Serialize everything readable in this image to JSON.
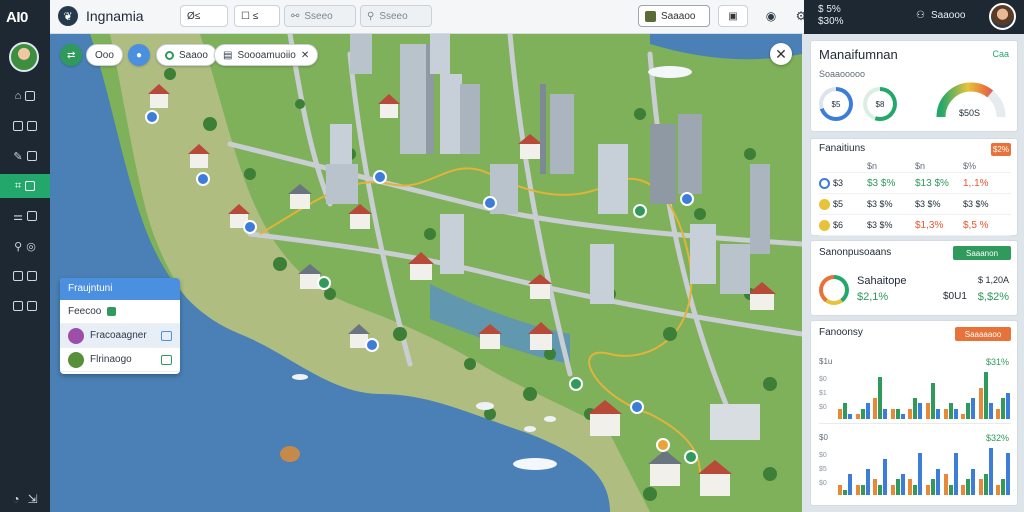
{
  "app": {
    "logo": "AI0",
    "title": "Ingnamia"
  },
  "toolbar": {
    "view_btn": "Ø≤",
    "tools_btn": "☐ ≤",
    "search1": "Sseeo",
    "search2": "Sseeo",
    "status_btn": "Saaaoo",
    "stat_line1": "$ 5%",
    "stat_line2": "$30%",
    "user_label": "Saaooo"
  },
  "map_chips": {
    "chip1": "Ooo",
    "chip2": "Saaoo",
    "chip3": "Soooamuoiio"
  },
  "layers": {
    "header": "Fraujntuni",
    "row1": "Feecoo",
    "row2": "Fracoaagner",
    "row3": "Flrinaogo"
  },
  "panel": {
    "card1": {
      "title": "Manaifumnan",
      "tag": "Caa",
      "subtitle": "Soaaooooo",
      "ring1": "$5",
      "ring2": "$8",
      "gauge_label": "$50S",
      "gauge_percent": 72,
      "color_accent": "#22a86b"
    },
    "card2": {
      "title": "Fanaitiuns",
      "badge": "$2%",
      "headers": [
        "",
        "$n",
        "$n",
        "$%"
      ],
      "rows": [
        [
          "$3",
          "$3 $%",
          "$13 $%",
          "1,.1%"
        ],
        [
          "$5",
          "$3 $%",
          "$3 $%",
          "$3 $%"
        ],
        [
          "$6",
          "$3 $%",
          "$1,3%",
          "$,5 %"
        ]
      ]
    },
    "card3": {
      "title": "Sanonpusoaans",
      "button": "Saaanon",
      "item_title": "Sahaitope",
      "item_value": "$ 1,20A",
      "pct1": "$2,1%",
      "pct2": "$0U1",
      "pct3": "$,$2%"
    },
    "card4": {
      "title": "Fanoonsy",
      "button": "Saaaaaoo",
      "chart1": {
        "label_left": "$1u",
        "label_right": "$31%",
        "ticks": [
          "$0",
          "$1",
          "$0"
        ],
        "colors": [
          "#e8893a",
          "#2f9a5c",
          "#3b7dd8"
        ],
        "series": [
          {
            "values": [
              0.2,
              0.1,
              0.4,
              0.2,
              0.2,
              0.3,
              0.2,
              0.1,
              0.6,
              0.2
            ]
          },
          {
            "values": [
              0.3,
              0.2,
              0.8,
              0.2,
              0.4,
              0.7,
              0.3,
              0.3,
              0.9,
              0.4
            ]
          },
          {
            "values": [
              0.1,
              0.3,
              0.2,
              0.1,
              0.3,
              0.2,
              0.2,
              0.4,
              0.3,
              0.5
            ]
          }
        ]
      },
      "chart2": {
        "label_left": "$0",
        "label_right": "$32%",
        "ticks": [
          "$0",
          "$5",
          "$0"
        ],
        "colors": [
          "#e8893a",
          "#2f9a5c",
          "#3b7dd8"
        ],
        "series": [
          {
            "values": [
              0.2,
              0.2,
              0.3,
              0.2,
              0.3,
              0.2,
              0.4,
              0.2,
              0.3,
              0.2
            ]
          },
          {
            "values": [
              0.1,
              0.2,
              0.2,
              0.3,
              0.2,
              0.3,
              0.2,
              0.3,
              0.4,
              0.3
            ]
          },
          {
            "values": [
              0.4,
              0.5,
              0.7,
              0.4,
              0.8,
              0.5,
              0.8,
              0.5,
              0.9,
              0.8
            ]
          }
        ]
      }
    }
  }
}
